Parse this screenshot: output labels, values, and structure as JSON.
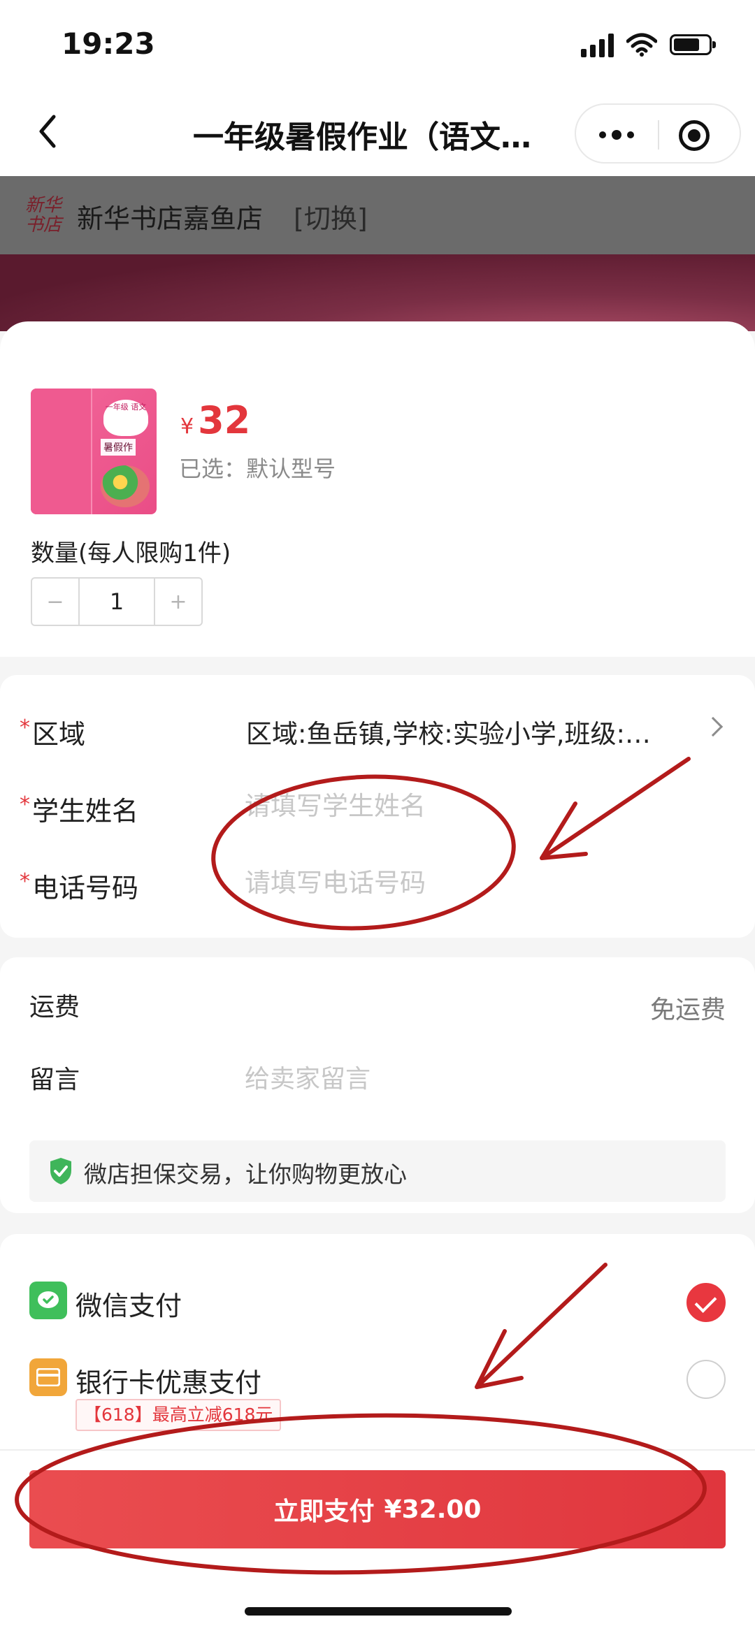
{
  "status_bar": {
    "time": "19:23"
  },
  "nav": {
    "title": "一年级暑假作业（语文…"
  },
  "store": {
    "logo_text": "新华书店",
    "name": "新华书店嘉鱼店",
    "switch_label": "[切换]"
  },
  "product": {
    "cover_badge": "一年级 语文",
    "cover_subtitle": "暑假作",
    "price_symbol": "¥",
    "price": "32",
    "selected_spec": "已选：默认型号",
    "quantity_label": "数量(每人限购1件)",
    "quantity": "1",
    "minus": "−",
    "plus": "+"
  },
  "form": {
    "required_mark": "*",
    "region_label": "区域",
    "region_value": "区域:鱼岳镇,学校:实验小学,班级:…",
    "student_name_label": "学生姓名",
    "student_name_placeholder": "请填写学生姓名",
    "phone_label": "电话号码",
    "phone_placeholder": "请填写电话号码"
  },
  "info": {
    "shipping_label": "运费",
    "shipping_value": "免运费",
    "message_label": "留言",
    "message_placeholder": "给卖家留言",
    "guarantee_text": "微店担保交易，让你购物更放心"
  },
  "payment": {
    "wechat_label": "微信支付",
    "wechat_checked": true,
    "bank_label": "银行卡优惠支付",
    "bank_checked": false,
    "promo_tag": "【618】最高立减618元"
  },
  "checkout": {
    "pay_label": "立即支付",
    "pay_amount": "¥32.00"
  },
  "colors": {
    "accent": "#e3363c",
    "annotation": "#b31b1b",
    "wechat": "#3fbf5b",
    "card": "#f1a63a"
  },
  "icons": [
    "back-icon",
    "more-icon",
    "close-icon",
    "shield-icon",
    "wechat-icon",
    "bank-card-icon",
    "chevron-right-icon",
    "check-icon"
  ]
}
